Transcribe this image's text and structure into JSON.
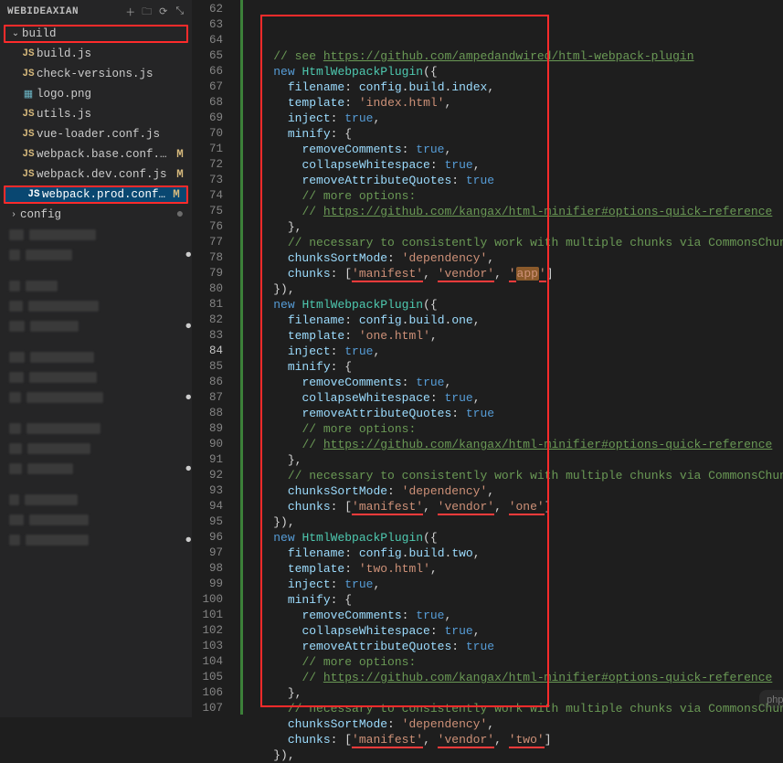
{
  "sidebar": {
    "title": "WEBIDEAXIAN",
    "actions": {
      "new_file": "＋",
      "new_folder": "🗀",
      "refresh": "⟳",
      "collapse": "⤡"
    },
    "folder": {
      "name": "build",
      "expanded": true
    },
    "files": [
      {
        "icon": "JS",
        "name": "build.js",
        "modified": false
      },
      {
        "icon": "JS",
        "name": "check-versions.js",
        "modified": false
      },
      {
        "icon": "IMG",
        "name": "logo.png",
        "modified": false
      },
      {
        "icon": "JS",
        "name": "utils.js",
        "modified": false
      },
      {
        "icon": "JS",
        "name": "vue-loader.conf.js",
        "modified": false
      },
      {
        "icon": "JS",
        "name": "webpack.base.conf.js",
        "modified": true
      },
      {
        "icon": "JS",
        "name": "webpack.dev.conf.js",
        "modified": true
      },
      {
        "icon": "JS",
        "name": "webpack.prod.conf.js",
        "modified": true,
        "selected": true
      },
      {
        "icon": ">",
        "name": "config",
        "modified": false,
        "folder": true,
        "dot": true
      }
    ]
  },
  "editor": {
    "first_line": 62,
    "active_line": 84,
    "lines": [
      [
        {
          "cls": "cmt",
          "t": "// see "
        },
        {
          "cls": "lnk",
          "t": "https://github.com/ampedandwired/html-webpack-plugin"
        }
      ],
      [
        {
          "cls": "kw",
          "t": "new"
        },
        {
          "t": " "
        },
        {
          "cls": "cls",
          "t": "HtmlWebpackPlugin"
        },
        {
          "cls": "pn",
          "t": "({"
        }
      ],
      [
        {
          "t": "  "
        },
        {
          "cls": "prop",
          "t": "filename"
        },
        {
          "cls": "pn",
          "t": ": "
        },
        {
          "cls": "prop",
          "t": "config"
        },
        {
          "cls": "pn",
          "t": "."
        },
        {
          "cls": "prop",
          "t": "build"
        },
        {
          "cls": "pn",
          "t": "."
        },
        {
          "cls": "prop",
          "t": "index"
        },
        {
          "cls": "pn",
          "t": ","
        }
      ],
      [
        {
          "t": "  "
        },
        {
          "cls": "prop",
          "t": "template"
        },
        {
          "cls": "pn",
          "t": ": "
        },
        {
          "cls": "str",
          "t": "'index.html'"
        },
        {
          "cls": "pn",
          "t": ","
        }
      ],
      [
        {
          "t": "  "
        },
        {
          "cls": "prop",
          "t": "inject"
        },
        {
          "cls": "pn",
          "t": ": "
        },
        {
          "cls": "bool",
          "t": "true"
        },
        {
          "cls": "pn",
          "t": ","
        }
      ],
      [
        {
          "t": "  "
        },
        {
          "cls": "prop",
          "t": "minify"
        },
        {
          "cls": "pn",
          "t": ": {"
        }
      ],
      [
        {
          "t": "    "
        },
        {
          "cls": "prop",
          "t": "removeComments"
        },
        {
          "cls": "pn",
          "t": ": "
        },
        {
          "cls": "bool",
          "t": "true"
        },
        {
          "cls": "pn",
          "t": ","
        }
      ],
      [
        {
          "t": "    "
        },
        {
          "cls": "prop",
          "t": "collapseWhitespace"
        },
        {
          "cls": "pn",
          "t": ": "
        },
        {
          "cls": "bool",
          "t": "true"
        },
        {
          "cls": "pn",
          "t": ","
        }
      ],
      [
        {
          "t": "    "
        },
        {
          "cls": "prop",
          "t": "removeAttributeQuotes"
        },
        {
          "cls": "pn",
          "t": ": "
        },
        {
          "cls": "bool",
          "t": "true"
        }
      ],
      [
        {
          "t": "    "
        },
        {
          "cls": "cmt",
          "t": "// more options:"
        }
      ],
      [
        {
          "t": "    "
        },
        {
          "cls": "cmt",
          "t": "// "
        },
        {
          "cls": "lnk",
          "t": "https://github.com/kangax/html-minifier#options-quick-reference"
        }
      ],
      [
        {
          "t": "  "
        },
        {
          "cls": "pn",
          "t": "},"
        }
      ],
      [
        {
          "t": "  "
        },
        {
          "cls": "cmt",
          "t": "// necessary to consistently work with multiple chunks via CommonsChunkPlugin"
        }
      ],
      [
        {
          "t": "  "
        },
        {
          "cls": "prop",
          "t": "chunksSortMode"
        },
        {
          "cls": "pn",
          "t": ": "
        },
        {
          "cls": "str",
          "t": "'dependency'"
        },
        {
          "cls": "pn",
          "t": ","
        }
      ],
      [
        {
          "t": "  "
        },
        {
          "cls": "prop",
          "t": "chunks"
        },
        {
          "cls": "pn",
          "t": ": ["
        },
        {
          "cls": "str underline-red",
          "t": "'manifest'"
        },
        {
          "cls": "pn",
          "t": ", "
        },
        {
          "cls": "str underline-red",
          "t": "'vendor'"
        },
        {
          "cls": "pn",
          "t": ", "
        },
        {
          "cls": "str underline-red",
          "t": "'",
          "wrap": "start"
        },
        {
          "cls": "str sel-bg",
          "t": "app"
        },
        {
          "cls": "str underline-red",
          "t": "'"
        },
        {
          "cls": "pn",
          "t": "]"
        }
      ],
      [
        {
          "cls": "pn",
          "t": "}),"
        }
      ],
      [
        {
          "cls": "kw",
          "t": "new"
        },
        {
          "t": " "
        },
        {
          "cls": "cls",
          "t": "HtmlWebpackPlugin"
        },
        {
          "cls": "pn",
          "t": "({"
        }
      ],
      [
        {
          "t": "  "
        },
        {
          "cls": "prop",
          "t": "filename"
        },
        {
          "cls": "pn",
          "t": ": "
        },
        {
          "cls": "prop",
          "t": "config"
        },
        {
          "cls": "pn",
          "t": "."
        },
        {
          "cls": "prop",
          "t": "build"
        },
        {
          "cls": "pn",
          "t": "."
        },
        {
          "cls": "prop",
          "t": "one"
        },
        {
          "cls": "pn",
          "t": ","
        }
      ],
      [
        {
          "t": "  "
        },
        {
          "cls": "prop",
          "t": "template"
        },
        {
          "cls": "pn",
          "t": ": "
        },
        {
          "cls": "str",
          "t": "'one.html'"
        },
        {
          "cls": "pn",
          "t": ","
        }
      ],
      [
        {
          "t": "  "
        },
        {
          "cls": "prop",
          "t": "inject"
        },
        {
          "cls": "pn",
          "t": ": "
        },
        {
          "cls": "bool",
          "t": "true"
        },
        {
          "cls": "pn",
          "t": ","
        }
      ],
      [
        {
          "t": "  "
        },
        {
          "cls": "prop",
          "t": "minify"
        },
        {
          "cls": "pn",
          "t": ": {"
        }
      ],
      [
        {
          "t": "    "
        },
        {
          "cls": "prop",
          "t": "removeComments"
        },
        {
          "cls": "pn",
          "t": ": "
        },
        {
          "cls": "bool",
          "t": "true"
        },
        {
          "cls": "pn",
          "t": ","
        }
      ],
      [
        {
          "t": "    "
        },
        {
          "cls": "prop",
          "t": "collapseWhitespace"
        },
        {
          "cls": "pn",
          "t": ": "
        },
        {
          "cls": "bool",
          "t": "true"
        },
        {
          "cls": "pn",
          "t": ","
        }
      ],
      [
        {
          "t": "    "
        },
        {
          "cls": "prop",
          "t": "removeAttributeQuotes"
        },
        {
          "cls": "pn",
          "t": ": "
        },
        {
          "cls": "bool",
          "t": "true"
        }
      ],
      [
        {
          "t": "    "
        },
        {
          "cls": "cmt",
          "t": "// more options:"
        }
      ],
      [
        {
          "t": "    "
        },
        {
          "cls": "cmt",
          "t": "// "
        },
        {
          "cls": "lnk",
          "t": "https://github.com/kangax/html-minifier#options-quick-reference"
        }
      ],
      [
        {
          "t": "  "
        },
        {
          "cls": "pn",
          "t": "},"
        }
      ],
      [
        {
          "t": "  "
        },
        {
          "cls": "cmt",
          "t": "// necessary to consistently work with multiple chunks via CommonsChunkPlugin"
        }
      ],
      [
        {
          "t": "  "
        },
        {
          "cls": "prop",
          "t": "chunksSortMode"
        },
        {
          "cls": "pn",
          "t": ": "
        },
        {
          "cls": "str",
          "t": "'dependency'"
        },
        {
          "cls": "pn",
          "t": ","
        }
      ],
      [
        {
          "t": "  "
        },
        {
          "cls": "prop",
          "t": "chunks"
        },
        {
          "cls": "pn",
          "t": ": ["
        },
        {
          "cls": "str underline-red",
          "t": "'manifest'"
        },
        {
          "cls": "pn",
          "t": ", "
        },
        {
          "cls": "str underline-red",
          "t": "'vendor'"
        },
        {
          "cls": "pn",
          "t": ", "
        },
        {
          "cls": "str underline-red",
          "t": "'one'"
        },
        {
          "cls": "pn",
          "t": "]"
        }
      ],
      [
        {
          "cls": "pn",
          "t": "}),"
        }
      ],
      [
        {
          "cls": "kw",
          "t": "new"
        },
        {
          "t": " "
        },
        {
          "cls": "cls",
          "t": "HtmlWebpackPlugin"
        },
        {
          "cls": "pn",
          "t": "({"
        }
      ],
      [
        {
          "t": "  "
        },
        {
          "cls": "prop",
          "t": "filename"
        },
        {
          "cls": "pn",
          "t": ": "
        },
        {
          "cls": "prop",
          "t": "config"
        },
        {
          "cls": "pn",
          "t": "."
        },
        {
          "cls": "prop",
          "t": "build"
        },
        {
          "cls": "pn",
          "t": "."
        },
        {
          "cls": "prop",
          "t": "two"
        },
        {
          "cls": "pn",
          "t": ","
        }
      ],
      [
        {
          "t": "  "
        },
        {
          "cls": "prop",
          "t": "template"
        },
        {
          "cls": "pn",
          "t": ": "
        },
        {
          "cls": "str",
          "t": "'two.html'"
        },
        {
          "cls": "pn",
          "t": ","
        }
      ],
      [
        {
          "t": "  "
        },
        {
          "cls": "prop",
          "t": "inject"
        },
        {
          "cls": "pn",
          "t": ": "
        },
        {
          "cls": "bool",
          "t": "true"
        },
        {
          "cls": "pn",
          "t": ","
        }
      ],
      [
        {
          "t": "  "
        },
        {
          "cls": "prop",
          "t": "minify"
        },
        {
          "cls": "pn",
          "t": ": {"
        }
      ],
      [
        {
          "t": "    "
        },
        {
          "cls": "prop",
          "t": "removeComments"
        },
        {
          "cls": "pn",
          "t": ": "
        },
        {
          "cls": "bool",
          "t": "true"
        },
        {
          "cls": "pn",
          "t": ","
        }
      ],
      [
        {
          "t": "    "
        },
        {
          "cls": "prop",
          "t": "collapseWhitespace"
        },
        {
          "cls": "pn",
          "t": ": "
        },
        {
          "cls": "bool",
          "t": "true"
        },
        {
          "cls": "pn",
          "t": ","
        }
      ],
      [
        {
          "t": "    "
        },
        {
          "cls": "prop",
          "t": "removeAttributeQuotes"
        },
        {
          "cls": "pn",
          "t": ": "
        },
        {
          "cls": "bool",
          "t": "true"
        }
      ],
      [
        {
          "t": "    "
        },
        {
          "cls": "cmt",
          "t": "// more options:"
        }
      ],
      [
        {
          "t": "    "
        },
        {
          "cls": "cmt",
          "t": "// "
        },
        {
          "cls": "lnk",
          "t": "https://github.com/kangax/html-minifier#options-quick-reference"
        }
      ],
      [
        {
          "t": "  "
        },
        {
          "cls": "pn",
          "t": "},"
        }
      ],
      [
        {
          "t": "  "
        },
        {
          "cls": "cmt",
          "t": "// necessary to consistently work with multiple chunks via CommonsChunkPlugin"
        }
      ],
      [
        {
          "t": "  "
        },
        {
          "cls": "prop",
          "t": "chunksSortMode"
        },
        {
          "cls": "pn",
          "t": ": "
        },
        {
          "cls": "str",
          "t": "'dependency'"
        },
        {
          "cls": "pn",
          "t": ","
        }
      ],
      [
        {
          "t": "  "
        },
        {
          "cls": "prop",
          "t": "chunks"
        },
        {
          "cls": "pn",
          "t": ": ["
        },
        {
          "cls": "str underline-red",
          "t": "'manifest'"
        },
        {
          "cls": "pn",
          "t": ", "
        },
        {
          "cls": "str underline-red",
          "t": "'vendor'"
        },
        {
          "cls": "pn",
          "t": ", "
        },
        {
          "cls": "str underline-red",
          "t": "'two'"
        },
        {
          "cls": "pn",
          "t": "]"
        }
      ],
      [
        {
          "cls": "pn",
          "t": "}),"
        }
      ]
    ],
    "indent_base": "    "
  },
  "watermark": "php 中文网"
}
